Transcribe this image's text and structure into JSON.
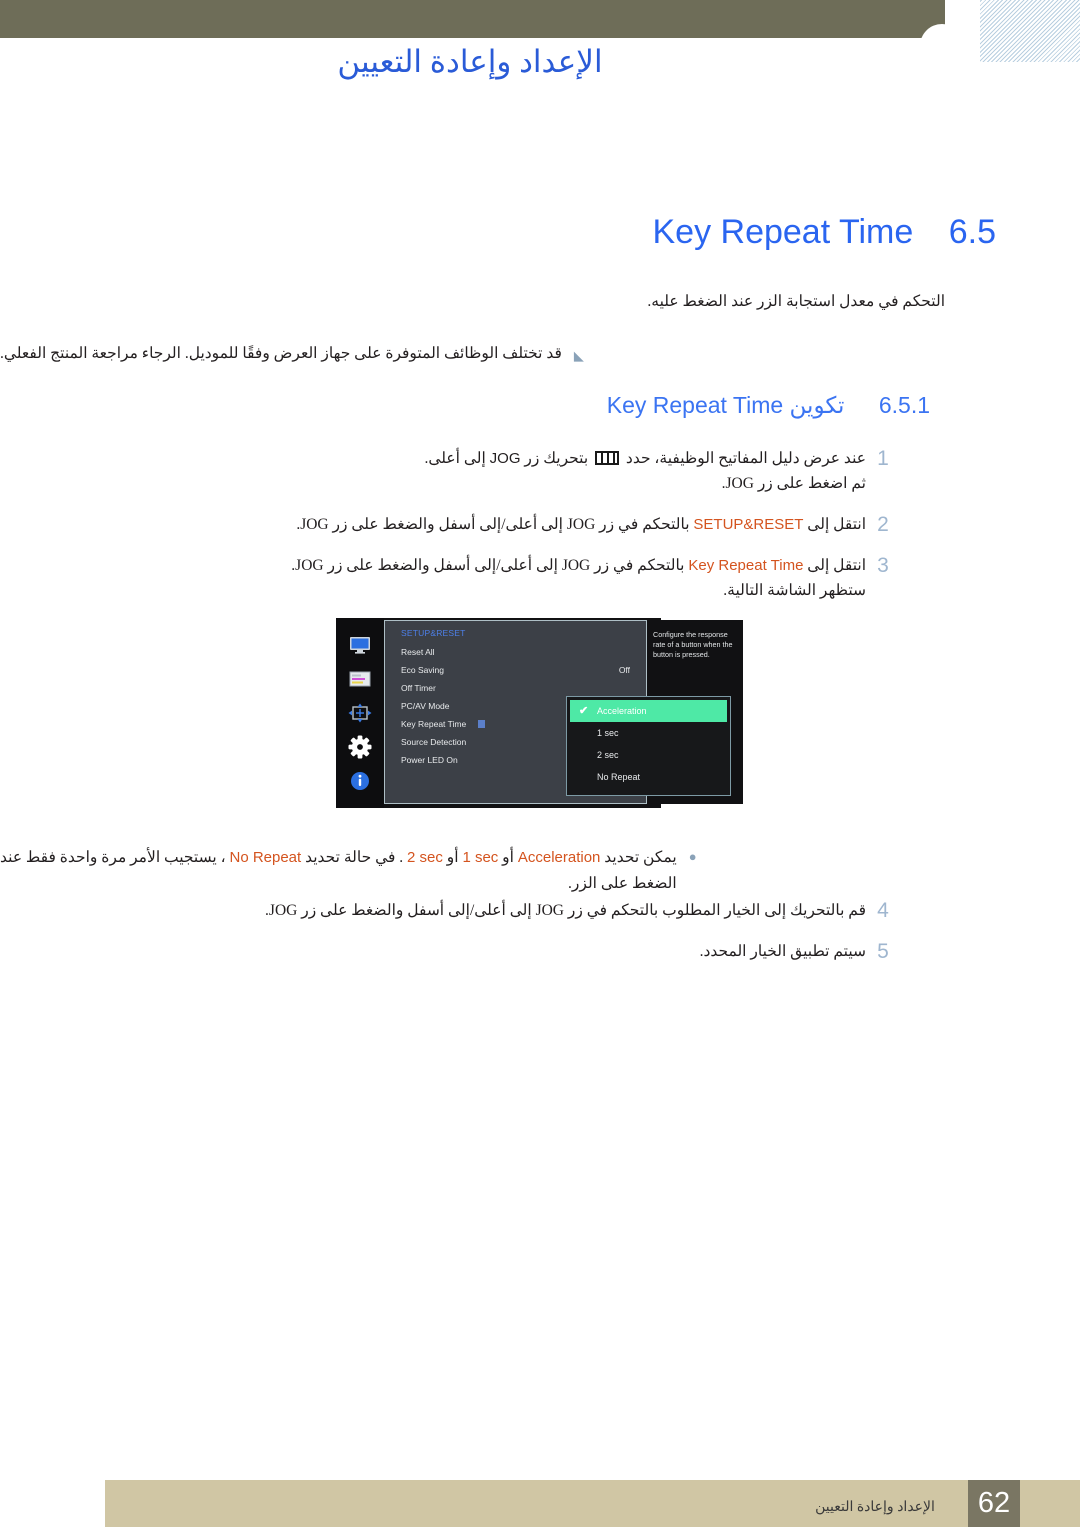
{
  "header": {
    "title": "الإعداد وإعادة التعيين",
    "bar_color": "#6e6d58",
    "title_color": "#2a5bd7"
  },
  "main_heading": {
    "section_number": "6.5",
    "section_title": "Key Repeat Time",
    "color": "#2a65f0"
  },
  "description": "التحكم في معدل استجابة الزر عند الضغط عليه.",
  "note_top": {
    "bullet": "◣",
    "text": "قد تختلف الوظائف المتوفرة على جهاز العرض وفقًا للموديل. الرجاء مراجعة المنتج الفعلي."
  },
  "sub_heading": {
    "number": "6.5.1",
    "arabic": "تكوين",
    "english": "Key Repeat Time",
    "color": "#3b74f2"
  },
  "steps_top": [
    {
      "number": "1",
      "lead": "عند عرض دليل المفاتيح الوظيفية، حدد",
      "icon": "menu-bracket-icon",
      "mid": "بتحريك زر",
      "jog": "JOG",
      "tail": "إلى أعلى.",
      "line2": "ثم اضغط على زر JOG."
    },
    {
      "number": "2",
      "before": "انتقل إلى",
      "keyword": "SETUP&RESET",
      "after": "بالتحكم في زر JOG إلى أعلى/إلى أسفل والضغط على زر JOG."
    },
    {
      "number": "3",
      "before": "انتقل إلى",
      "keyword": "Key Repeat Time",
      "after": "بالتحكم في زر JOG إلى أعلى/إلى أسفل والضغط على زر JOG.",
      "line2": "ستظهر الشاشة التالية."
    }
  ],
  "osd": {
    "menu_title": "SETUP&RESET",
    "sidebar_icons": [
      "monitor-icon",
      "picture-settings-icon",
      "screen-adjust-icon",
      "gear-icon",
      "info-icon"
    ],
    "items": [
      {
        "label": "Reset All",
        "value": ""
      },
      {
        "label": "Eco Saving",
        "value": "Off"
      },
      {
        "label": "Off Timer",
        "value": ""
      },
      {
        "label": "PC/AV Mode",
        "value": ""
      },
      {
        "label": "Key Repeat Time",
        "value": ""
      },
      {
        "label": "Source Detection",
        "value": ""
      },
      {
        "label": "Power LED On",
        "value": ""
      }
    ],
    "submenu": [
      {
        "label": "Acceleration",
        "selected": true
      },
      {
        "label": "1 sec",
        "selected": false
      },
      {
        "label": "2 sec",
        "selected": false
      },
      {
        "label": "No Repeat",
        "selected": false
      }
    ],
    "help_text": "Configure the response rate of a button when the button is pressed.",
    "highlight_color": "#4ee9a6",
    "title_color": "#4d7fe8",
    "check_glyph": "✔"
  },
  "note_bottom": {
    "bullet": "●",
    "part1": "يمكن تحديد",
    "kw1": "Acceleration",
    "or1": "أو",
    "kw2": "1 sec",
    "or2": "أو",
    "kw3": "2 sec",
    "part2": ". في حالة تحديد",
    "kw4": "No Repeat",
    "part3": "، يستجيب الأمر مرة واحدة فقط عند",
    "line2": "الضغط على الزر."
  },
  "steps_bottom": [
    {
      "number": "4",
      "text": "قم بالتحريك إلى الخيار المطلوب بالتحكم في زر JOG إلى أعلى/إلى أسفل والضغط على زر JOG."
    },
    {
      "number": "5",
      "text": "سيتم تطبيق الخيار المحدد."
    }
  ],
  "footer": {
    "page_number": "62",
    "chapter_title": "الإعداد وإعادة التعيين",
    "band_color": "#d0c6a4",
    "page_box_color": "#7a7663"
  }
}
